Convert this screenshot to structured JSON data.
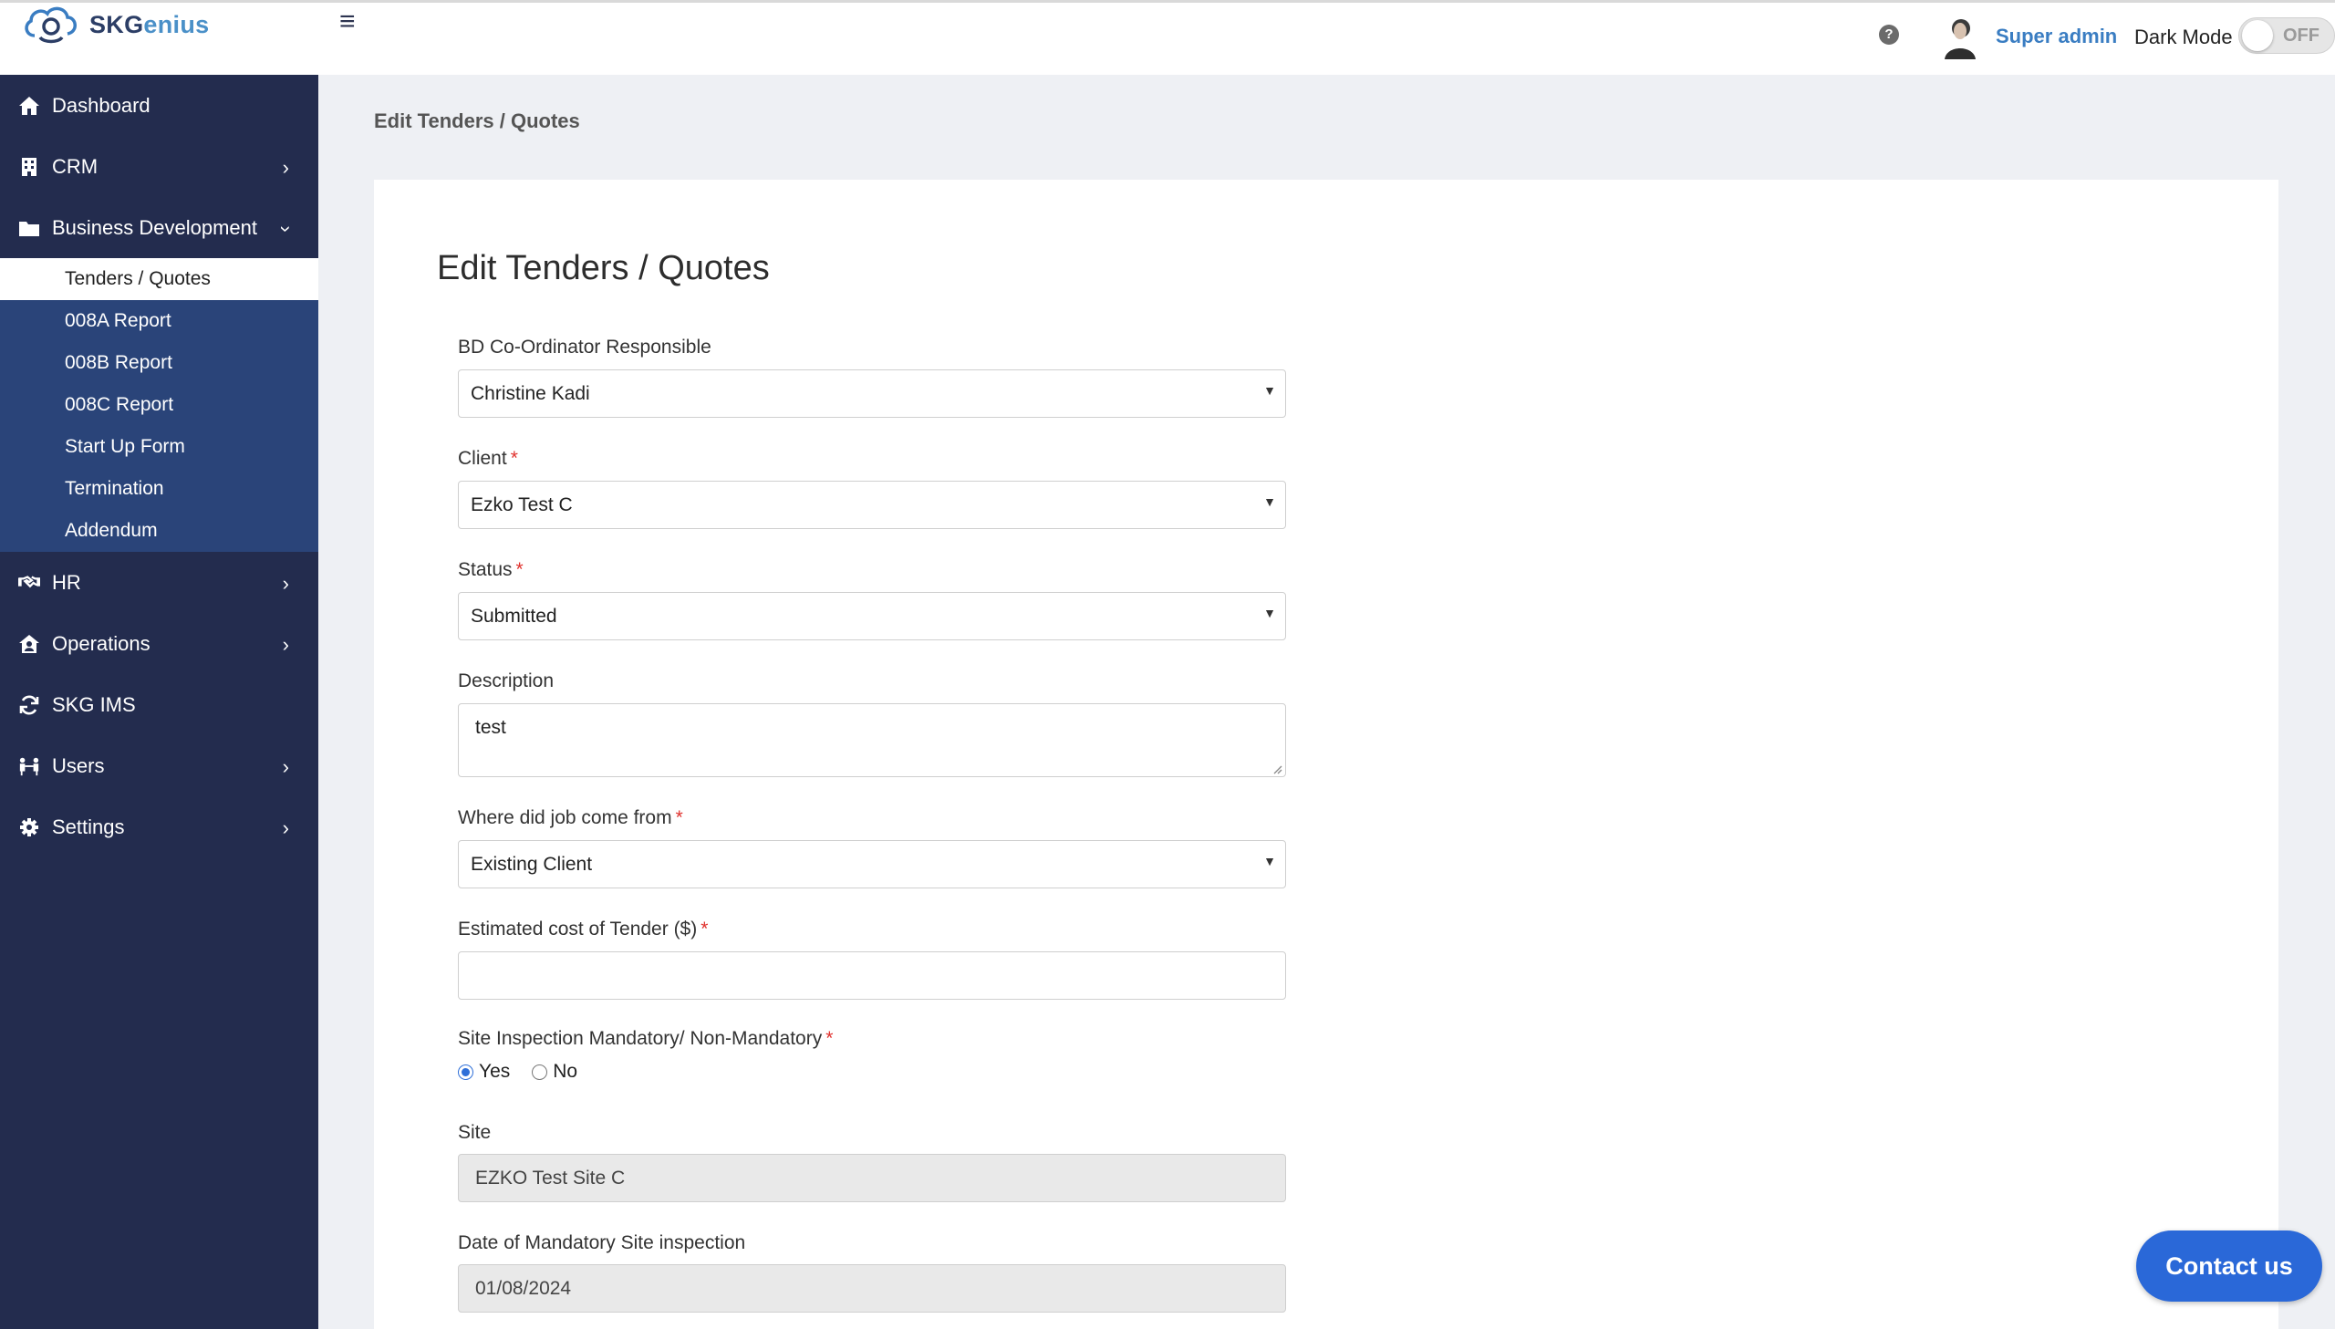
{
  "app": {
    "logo_text_a": "SKG",
    "logo_text_b": "enius",
    "logo_text_g": "G"
  },
  "header": {
    "user_name": "Super admin",
    "dark_mode_label": "Dark Mode",
    "dark_mode_state": "OFF"
  },
  "sidebar": {
    "items": [
      {
        "label": "Dashboard",
        "icon": "home-icon"
      },
      {
        "label": "CRM",
        "icon": "building-icon"
      },
      {
        "label": "Business Development",
        "icon": "folder-icon"
      },
      {
        "label": "HR",
        "icon": "handshake-icon"
      },
      {
        "label": "Operations",
        "icon": "house-user-icon"
      },
      {
        "label": "SKG IMS",
        "icon": "sync-icon"
      },
      {
        "label": "Users",
        "icon": "users-icon"
      },
      {
        "label": "Settings",
        "icon": "gear-icon"
      }
    ],
    "submenu": [
      "Tenders / Quotes",
      "008A Report",
      "008B Report",
      "008C Report",
      "Start Up Form",
      "Termination",
      "Addendum"
    ]
  },
  "main": {
    "breadcrumb": "Edit Tenders / Quotes",
    "title": "Edit Tenders / Quotes",
    "fields": {
      "bd_coordinator": {
        "label": "BD Co-Ordinator Responsible",
        "value": "Christine Kadi"
      },
      "client": {
        "label": "Client",
        "value": "Ezko Test C",
        "required": "*"
      },
      "status": {
        "label": "Status",
        "value": "Submitted",
        "required": "*"
      },
      "description": {
        "label": "Description",
        "value": "test"
      },
      "job_source": {
        "label": "Where did job come from",
        "value": "Existing Client",
        "required": "*"
      },
      "estimated_cost": {
        "label": "Estimated cost of Tender ($)",
        "value": "",
        "required": "*"
      },
      "site_inspection": {
        "label": "Site Inspection Mandatory/ Non-Mandatory",
        "required": "*",
        "options": [
          "Yes",
          "No"
        ],
        "selected": "Yes"
      },
      "site": {
        "label": "Site",
        "value": "EZKO Test Site C"
      },
      "inspection_date": {
        "label": "Date of Mandatory Site inspection",
        "value": "01/08/2024"
      }
    }
  },
  "contact_button": "Contact us",
  "colors": {
    "sidebar_bg": "#232c4e",
    "submenu_bg": "#2a4479",
    "accent": "#2a68d8",
    "link": "#3a7dc2",
    "required": "#e0322e"
  }
}
